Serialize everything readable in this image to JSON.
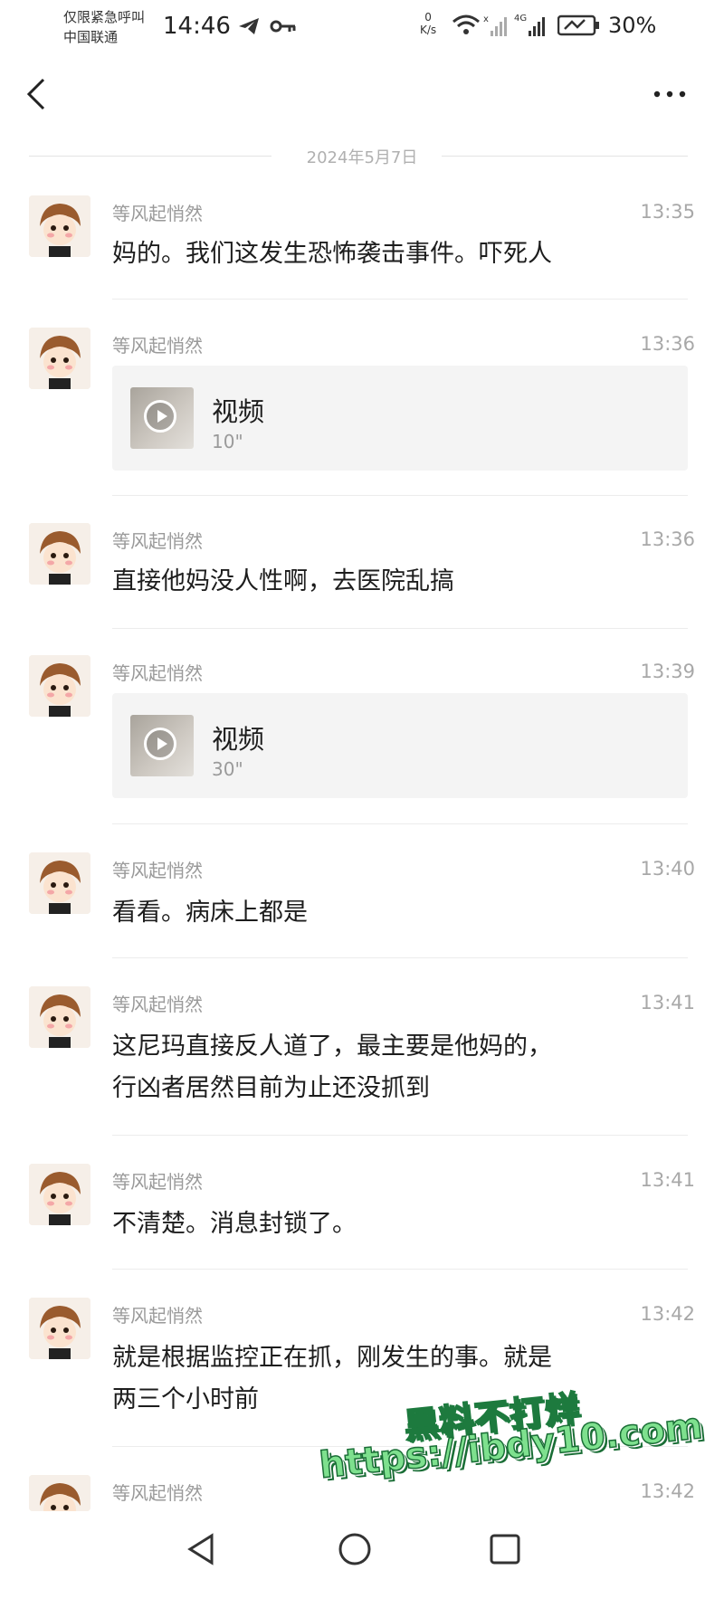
{
  "status_bar": {
    "carrier_line1": "仅限紧急呼叫",
    "carrier_line2": "中国联通",
    "time": "14:46",
    "net_speed_value": "0",
    "net_speed_unit": "K/s",
    "battery": "30%"
  },
  "chat": {
    "date": "2024年5月7日",
    "messages": [
      {
        "sender": "等风起悄然",
        "time": "13:35",
        "text": "妈的。我们这发生恐怖袭击事件。吓死人"
      },
      {
        "sender": "等风起悄然",
        "time": "13:36",
        "video_label": "视频",
        "video_duration": "10\""
      },
      {
        "sender": "等风起悄然",
        "time": "13:36",
        "text": "直接他妈没人性啊，去医院乱搞"
      },
      {
        "sender": "等风起悄然",
        "time": "13:39",
        "video_label": "视频",
        "video_duration": "30\""
      },
      {
        "sender": "等风起悄然",
        "time": "13:40",
        "text": "看看。病床上都是"
      },
      {
        "sender": "等风起悄然",
        "time": "13:41",
        "text_line1": "这尼玛直接反人道了，最主要是他妈的，",
        "text_line2": "行凶者居然目前为止还没抓到"
      },
      {
        "sender": "等风起悄然",
        "time": "13:41",
        "text": "不清楚。消息封锁了。"
      },
      {
        "sender": "等风起悄然",
        "time": "13:42",
        "text_line1": "就是根据监控正在抓，刚发生的事。就是",
        "text_line2": "两三个小时前"
      },
      {
        "sender": "等风起悄然",
        "time": "13:42"
      }
    ]
  },
  "watermark": {
    "line1": "黑料不打烊",
    "line2": "https://ibdy10.com"
  }
}
